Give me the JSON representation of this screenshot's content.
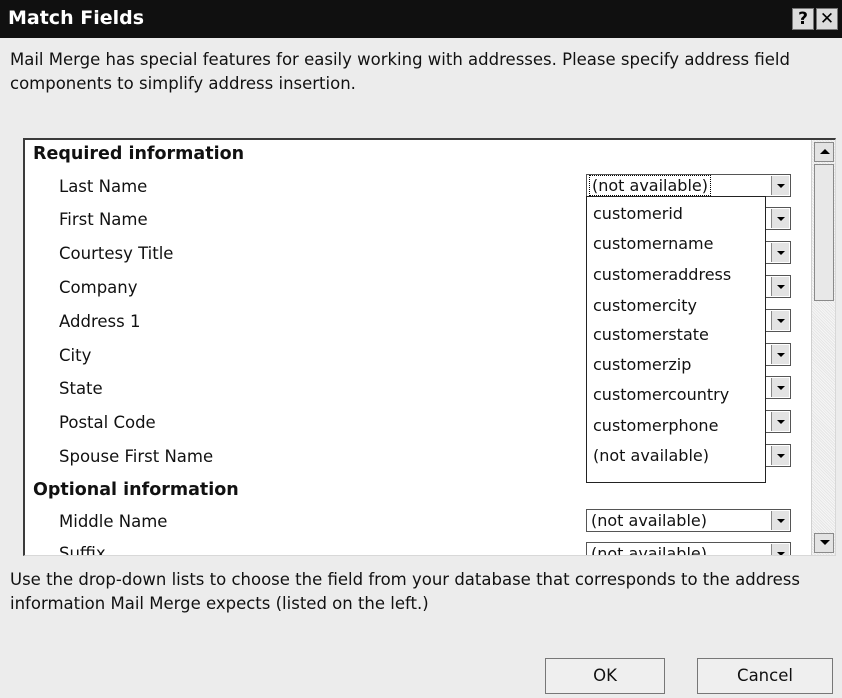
{
  "dialog": {
    "title": "Match Fields",
    "help_label": "?",
    "close_label": "✕",
    "intro": "Mail Merge has special features for easily working with addresses.  Please specify address field components to simplify address insertion.",
    "footer": "Use the drop-down lists to choose the field from your database that corresponds to the address information Mail Merge expects (listed on the left.)",
    "ok_label": "OK",
    "cancel_label": "Cancel"
  },
  "required": {
    "heading": "Required information",
    "fields": [
      {
        "label": "Last Name",
        "value": "(not available)"
      },
      {
        "label": "First Name",
        "value": ""
      },
      {
        "label": "Courtesy Title",
        "value": ""
      },
      {
        "label": "Company",
        "value": ""
      },
      {
        "label": "Address 1",
        "value": ""
      },
      {
        "label": "City",
        "value": ""
      },
      {
        "label": "State",
        "value": ""
      },
      {
        "label": "Postal Code",
        "value": ""
      },
      {
        "label": "Spouse First Name",
        "value": ""
      }
    ]
  },
  "optional": {
    "heading": "Optional information",
    "fields": [
      {
        "label": "Middle Name",
        "value": "(not available)"
      },
      {
        "label": "Suffix",
        "value": "(not available)"
      }
    ]
  },
  "dropdown_options": [
    "customerid",
    "customername",
    "customeraddress",
    "customercity",
    "customerstate",
    "customerzip",
    "customercountry",
    "customerphone",
    "(not available)"
  ],
  "icons": {
    "dropdown_arrow": "chevron-down-icon",
    "scroll_up": "arrow-up-icon",
    "scroll_down": "arrow-down-icon"
  },
  "colors": {
    "titlebar": "#101010",
    "dialog_bg": "#ececec",
    "list_bg": "#ffffff"
  }
}
